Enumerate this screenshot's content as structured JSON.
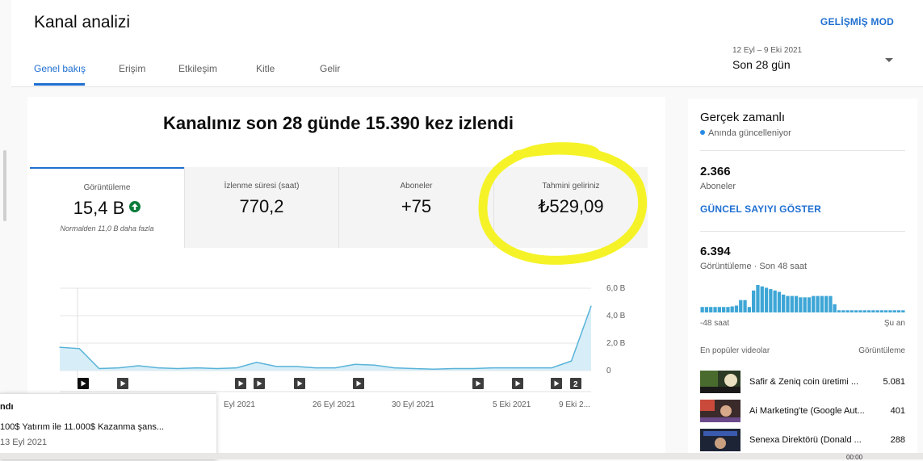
{
  "header": {
    "title": "Kanal analizi",
    "advanced_mode": "GELİŞMİŞ MOD",
    "tabs": [
      {
        "label": "Genel bakış",
        "active": true
      },
      {
        "label": "Erişim"
      },
      {
        "label": "Etkileşim"
      },
      {
        "label": "Kitle"
      },
      {
        "label": "Gelir"
      }
    ],
    "date_range": {
      "dates": "12 Eyl – 9 Eki 2021",
      "label": "Son 28 gün"
    }
  },
  "overview": {
    "headline": "Kanalınız son 28 günde 15.390 kez izlendi",
    "metrics": [
      {
        "label": "Görüntüleme",
        "value": "15,4 B",
        "note": "Normalden 11,0 B daha fazla",
        "trend": "up"
      },
      {
        "label": "İzlenme süresi (saat)",
        "value": "770,2"
      },
      {
        "label": "Aboneler",
        "value": "+75"
      },
      {
        "label": "Tahmini geliriniz",
        "value": "₺529,09"
      }
    ]
  },
  "chart_data": {
    "type": "area",
    "title": "",
    "xlabel": "",
    "ylabel": "",
    "y_tick_labels": [
      "0",
      "2,0 B",
      "4,0 B",
      "6,0 B"
    ],
    "ylim": [
      0,
      6.0
    ],
    "x_tick_labels": [
      "Eyl 2021",
      "26 Eyl 2021",
      "30 Eyl 2021",
      "5 Eki 2021",
      "9 Eki 2..."
    ],
    "series": [
      {
        "values": [
          1.7,
          1.6,
          0.15,
          0.2,
          0.35,
          0.2,
          0.15,
          0.2,
          0.15,
          0.2,
          0.6,
          0.3,
          0.3,
          0.2,
          0.2,
          0.45,
          0.4,
          0.2,
          0.15,
          0.1,
          0.15,
          0.15,
          0.2,
          0.2,
          0.2,
          0.2,
          0.7,
          4.7
        ]
      }
    ],
    "video_markers": [
      "▶",
      "▶",
      "▶",
      "▶",
      "▶",
      "▶",
      "▶",
      "▶",
      "▶",
      "2"
    ],
    "grid": true,
    "color": "#5ab3d8"
  },
  "tooltip": {
    "title": "ndı",
    "line": "100$ Yatırım ile 11.000$ Kazanma şans...",
    "date": "13 Eyl 2021"
  },
  "realtime": {
    "title": "Gerçek zamanlı",
    "status": "Anında güncelleniyor",
    "subscribers_value": "2.366",
    "subscribers_label": "Aboneler",
    "show_count_button": "GÜNCEL SAYIYI GÖSTER",
    "views_value": "6.394",
    "views_label": "Görüntüleme · Son 48 saat",
    "bars": [
      0.2,
      0.2,
      0.2,
      0.2,
      0.2,
      0.2,
      0.2,
      0.22,
      0.25,
      0.45,
      0.45,
      0.2,
      0.8,
      1.0,
      0.95,
      0.9,
      0.85,
      0.8,
      0.75,
      0.65,
      0.6,
      0.6,
      0.6,
      0.55,
      0.55,
      0.55,
      0.6,
      0.6,
      0.6,
      0.6,
      0.6,
      0.3,
      0.08,
      0.08,
      0.08,
      0.08,
      0.08,
      0.08,
      0.08,
      0.08,
      0.08,
      0.08,
      0.08,
      0.08,
      0.08,
      0.08,
      0.08,
      0.08
    ],
    "axis_left": "-48 saat",
    "axis_right": "Şu an",
    "list_header_left": "En popüler videolar",
    "list_header_right": "Görüntüleme",
    "videos": [
      {
        "title": "Safir & Zeniq coin üretimi ...",
        "views": "5.081"
      },
      {
        "title": "Ai Marketing'te (Google Aut...",
        "views": "401"
      },
      {
        "title": "Senexa Direktörü (Donald ...",
        "views": "288"
      }
    ]
  }
}
